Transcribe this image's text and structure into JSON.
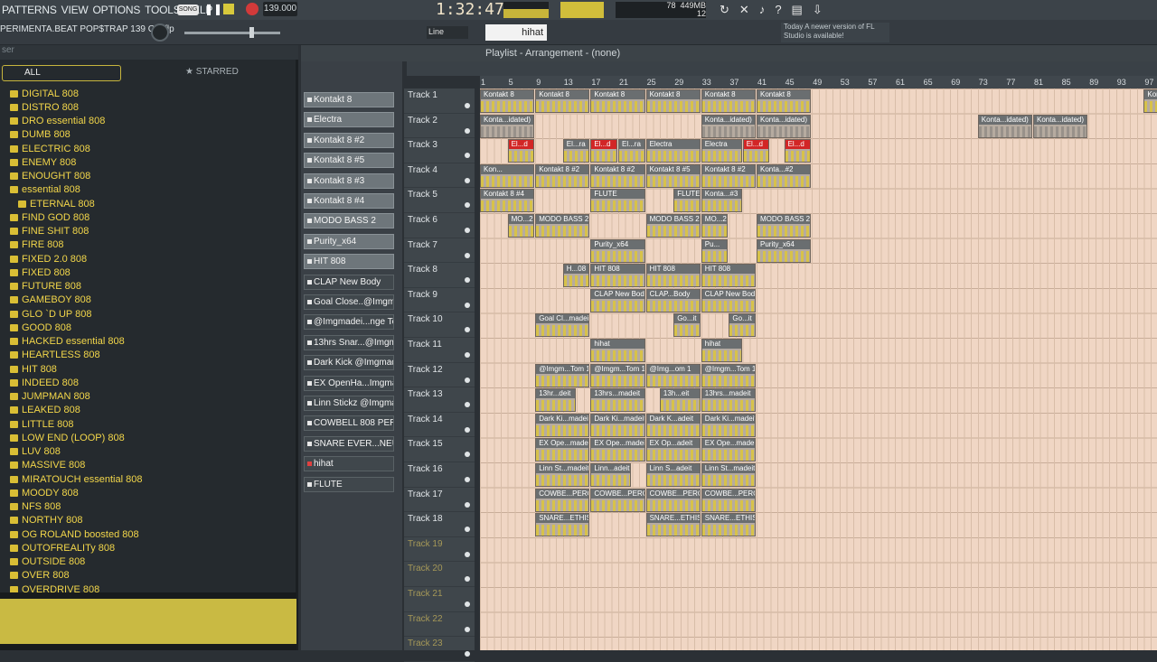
{
  "menu": [
    "PATTERNS",
    "VIEW",
    "OPTIONS",
    "TOOLS",
    "HELP"
  ],
  "transport": {
    "mode": "SONG",
    "tempo": "139.000",
    "time": "1:32:47",
    "memory": "449",
    "memory_unit": "MB",
    "cpu": "78",
    "polyphony": "12"
  },
  "project_file": "PERIMENTA.BEAT POP$TRAP 139 Cm.flp",
  "snap": "Line",
  "pattern_selector": "hihat",
  "news": {
    "today": "Today",
    "message": "A newer version of FL Studio is available!"
  },
  "browser": {
    "tab_all": "ALL",
    "tab_starred": "STARRED",
    "items": [
      "DIGITAL 808",
      "DISTRO 808",
      "DRO essential 808",
      "DUMB 808",
      "ELECTRIC 808",
      "ENEMY 808",
      "ENOUGHT 808",
      "essential 808",
      "ETERNAL 808",
      "FIND GOD 808",
      "FINE SHIT 808",
      "FIRE 808",
      "FIXED 2.0 808",
      "FIXED 808",
      "FUTURE 808",
      "GAMEBOY 808",
      "GLO `D UP 808",
      "GOOD 808",
      "HACKED essential 808",
      "HEARTLESS 808",
      "HIT 808",
      "INDEED 808",
      "JUMPMAN 808",
      "LEAKED 808",
      "LITTLE 808",
      "LOW END (LOOP) 808",
      "LUV 808",
      "MASSIVE 808",
      "MIRATOUCH essential 808",
      "MOODY 808",
      "NFS 808",
      "NORTHY 808",
      "OG ROLAND boosted 808",
      "OUTOFREALITy 808",
      "OUTSIDE 808",
      "OVER 808",
      "OVERDRIVE 808"
    ]
  },
  "channels": [
    "Kontakt 8",
    "Electra",
    "Kontakt 8 #2",
    "Kontakt 8 #5",
    "Kontakt 8 #3",
    "Kontakt 8 #4",
    "MODO BASS 2",
    "Purity_x64",
    "HIT 808",
    "CLAP New Body",
    "Goal Close..@Imgmadeit",
    "@Imgmadei...nge Tom 1",
    "13hrs Snar...@Imgmadeit",
    "Dark Kick @Imgmadeit",
    "EX OpenHa...Imgmadeit",
    "Linn Stickz @Imgmadeit",
    "COWBELL 808 PERC",
    "SNARE EVER...NEUSETHIS1",
    "hihat",
    "FLUTE"
  ],
  "playlist": {
    "title": "Playlist - Arrangement - (none)"
  },
  "ruler": [
    "1",
    "5",
    "9",
    "13",
    "17",
    "21",
    "25",
    "29",
    "33",
    "37",
    "41",
    "45",
    "49",
    "53",
    "57",
    "61",
    "65",
    "69",
    "73",
    "77",
    "81",
    "85",
    "89",
    "93",
    "97"
  ],
  "tracks": [
    "Track 1",
    "Track 2",
    "Track 3",
    "Track 4",
    "Track 5",
    "Track 6",
    "Track 7",
    "Track 8",
    "Track 9",
    "Track 10",
    "Track 11",
    "Track 12",
    "Track 13",
    "Track 14",
    "Track 15",
    "Track 16",
    "Track 17",
    "Track 18",
    "Track 19",
    "Track 20",
    "Track 21",
    "Track 22",
    "Track 23"
  ],
  "clips": [
    {
      "t": 0,
      "s": 1,
      "l": 4,
      "n": "Kontakt 8"
    },
    {
      "t": 0,
      "s": 5,
      "l": 4,
      "n": "Kontakt 8"
    },
    {
      "t": 0,
      "s": 9,
      "l": 4,
      "n": "Kontakt 8"
    },
    {
      "t": 0,
      "s": 13,
      "l": 4,
      "n": "Kontakt 8"
    },
    {
      "t": 0,
      "s": 17,
      "l": 4,
      "n": "Kontakt 8"
    },
    {
      "t": 0,
      "s": 21,
      "l": 4,
      "n": "Kontakt 8"
    },
    {
      "t": 0,
      "s": 49,
      "l": 4,
      "n": "Kontakt 8"
    },
    {
      "t": 0,
      "s": 53,
      "l": 4,
      "n": "Kontakt 8"
    },
    {
      "t": 0,
      "s": 57,
      "l": 4,
      "n": "Kontakt 8"
    },
    {
      "t": 0,
      "s": 61,
      "l": 4,
      "n": "Kontakt 8"
    },
    {
      "t": 0,
      "s": 65,
      "l": 4,
      "n": "Kontakt 8"
    },
    {
      "t": 1,
      "s": 1,
      "l": 4,
      "n": "Konta...idated)",
      "g": 1
    },
    {
      "t": 1,
      "s": 17,
      "l": 4,
      "n": "Konta...idated)",
      "g": 1
    },
    {
      "t": 1,
      "s": 21,
      "l": 4,
      "n": "Konta...idated)",
      "g": 1
    },
    {
      "t": 1,
      "s": 37,
      "l": 4,
      "n": "Konta...idated)",
      "g": 1
    },
    {
      "t": 1,
      "s": 41,
      "l": 4,
      "n": "Konta...idated)",
      "g": 1
    },
    {
      "t": 2,
      "s": 3,
      "l": 2,
      "n": "El...d",
      "r": 1
    },
    {
      "t": 2,
      "s": 7,
      "l": 2,
      "n": "El...ra"
    },
    {
      "t": 2,
      "s": 9,
      "l": 2,
      "n": "El...d",
      "r": 1
    },
    {
      "t": 2,
      "s": 11,
      "l": 2,
      "n": "El...ra"
    },
    {
      "t": 2,
      "s": 13,
      "l": 4,
      "n": "Electra"
    },
    {
      "t": 2,
      "s": 17,
      "l": 3,
      "n": "Electra"
    },
    {
      "t": 2,
      "s": 20,
      "l": 2,
      "n": "El...d",
      "r": 1
    },
    {
      "t": 2,
      "s": 23,
      "l": 2,
      "n": "El...d",
      "r": 1
    },
    {
      "t": 3,
      "s": 1,
      "l": 4,
      "n": "Kon..."
    },
    {
      "t": 3,
      "s": 5,
      "l": 4,
      "n": "Kontakt 8 #2"
    },
    {
      "t": 3,
      "s": 9,
      "l": 4,
      "n": "Kontakt 8 #2"
    },
    {
      "t": 3,
      "s": 13,
      "l": 4,
      "n": "Kontakt 8 #5"
    },
    {
      "t": 3,
      "s": 17,
      "l": 4,
      "n": "Kontakt 8 #2"
    },
    {
      "t": 3,
      "s": 21,
      "l": 4,
      "n": "Konta...#2"
    },
    {
      "t": 4,
      "s": 1,
      "l": 4,
      "n": "Kontakt 8 #4"
    },
    {
      "t": 4,
      "s": 9,
      "l": 4,
      "n": "FLUTE"
    },
    {
      "t": 4,
      "s": 15,
      "l": 2,
      "n": "FLUTE"
    },
    {
      "t": 4,
      "s": 17,
      "l": 3,
      "n": "Konta...#3"
    },
    {
      "t": 5,
      "s": 3,
      "l": 2,
      "n": "MO...2"
    },
    {
      "t": 5,
      "s": 5,
      "l": 4,
      "n": "MODO BASS 2"
    },
    {
      "t": 5,
      "s": 13,
      "l": 4,
      "n": "MODO BASS 2"
    },
    {
      "t": 5,
      "s": 17,
      "l": 2,
      "n": "MO...2"
    },
    {
      "t": 5,
      "s": 21,
      "l": 4,
      "n": "MODO BASS 2"
    },
    {
      "t": 6,
      "s": 9,
      "l": 4,
      "n": "Purity_x64"
    },
    {
      "t": 6,
      "s": 17,
      "l": 2,
      "n": "Pu..."
    },
    {
      "t": 6,
      "s": 21,
      "l": 4,
      "n": "Purity_x64"
    },
    {
      "t": 7,
      "s": 7,
      "l": 2,
      "n": "H...08"
    },
    {
      "t": 7,
      "s": 9,
      "l": 4,
      "n": "HIT 808"
    },
    {
      "t": 7,
      "s": 13,
      "l": 4,
      "n": "HIT 808"
    },
    {
      "t": 7,
      "s": 17,
      "l": 4,
      "n": "HIT 808"
    },
    {
      "t": 8,
      "s": 9,
      "l": 4,
      "n": "CLAP New Body"
    },
    {
      "t": 8,
      "s": 13,
      "l": 4,
      "n": "CLAP...Body"
    },
    {
      "t": 8,
      "s": 17,
      "l": 4,
      "n": "CLAP New Body"
    },
    {
      "t": 9,
      "s": 5,
      "l": 4,
      "n": "Goal Cl...madeit"
    },
    {
      "t": 9,
      "s": 15,
      "l": 2,
      "n": "Go...it"
    },
    {
      "t": 9,
      "s": 19,
      "l": 2,
      "n": "Go...it"
    },
    {
      "t": 10,
      "s": 9,
      "l": 4,
      "n": "hihat"
    },
    {
      "t": 10,
      "s": 17,
      "l": 3,
      "n": "hihat"
    },
    {
      "t": 11,
      "s": 5,
      "l": 4,
      "n": "@Imgm...Tom 1"
    },
    {
      "t": 11,
      "s": 9,
      "l": 4,
      "n": "@Imgm...Tom 1"
    },
    {
      "t": 11,
      "s": 13,
      "l": 4,
      "n": "@Img...om 1"
    },
    {
      "t": 11,
      "s": 17,
      "l": 4,
      "n": "@Imgm...Tom 1"
    },
    {
      "t": 12,
      "s": 5,
      "l": 3,
      "n": "13hr...deit"
    },
    {
      "t": 12,
      "s": 9,
      "l": 4,
      "n": "13hrs...madeit"
    },
    {
      "t": 12,
      "s": 14,
      "l": 3,
      "n": "13h...eit"
    },
    {
      "t": 12,
      "s": 17,
      "l": 4,
      "n": "13hrs...madeit"
    },
    {
      "t": 13,
      "s": 5,
      "l": 4,
      "n": "Dark Ki...madeit"
    },
    {
      "t": 13,
      "s": 9,
      "l": 4,
      "n": "Dark Ki...madeit"
    },
    {
      "t": 13,
      "s": 13,
      "l": 4,
      "n": "Dark K...adeit"
    },
    {
      "t": 13,
      "s": 17,
      "l": 4,
      "n": "Dark Ki...madeit"
    },
    {
      "t": 14,
      "s": 5,
      "l": 4,
      "n": "EX Ope...madeit"
    },
    {
      "t": 14,
      "s": 9,
      "l": 4,
      "n": "EX Ope...madeit"
    },
    {
      "t": 14,
      "s": 13,
      "l": 4,
      "n": "EX Op...adeit"
    },
    {
      "t": 14,
      "s": 17,
      "l": 4,
      "n": "EX Ope...madeit"
    },
    {
      "t": 15,
      "s": 5,
      "l": 4,
      "n": "Linn St...madeit"
    },
    {
      "t": 15,
      "s": 9,
      "l": 3,
      "n": "Linn...adeit"
    },
    {
      "t": 15,
      "s": 13,
      "l": 4,
      "n": "Linn S...adeit"
    },
    {
      "t": 15,
      "s": 17,
      "l": 4,
      "n": "Linn St...madeit"
    },
    {
      "t": 16,
      "s": 5,
      "l": 4,
      "n": "COWBE...PERC"
    },
    {
      "t": 16,
      "s": 9,
      "l": 4,
      "n": "COWBE...PERC"
    },
    {
      "t": 16,
      "s": 13,
      "l": 4,
      "n": "COWBE...PERC"
    },
    {
      "t": 16,
      "s": 17,
      "l": 4,
      "n": "COWBE...PERC"
    },
    {
      "t": 17,
      "s": 5,
      "l": 4,
      "n": "SNARE...ETHIS1"
    },
    {
      "t": 17,
      "s": 13,
      "l": 4,
      "n": "SNARE...ETHIS1"
    },
    {
      "t": 17,
      "s": 17,
      "l": 4,
      "n": "SNARE...ETHIS1"
    }
  ]
}
